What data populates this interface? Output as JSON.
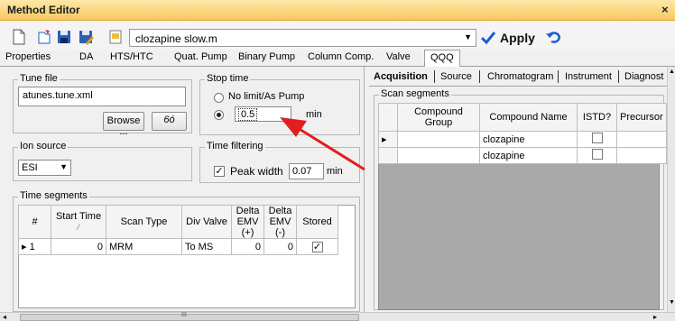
{
  "window": {
    "title": "Method Editor",
    "close_glyph": "×"
  },
  "toolbar": {
    "method_file": "clozapine slow.m",
    "apply_label": "Apply",
    "icons": [
      "new-icon",
      "open-icon",
      "save-icon",
      "save-as-icon",
      "print-preview-icon",
      "apply-check-icon",
      "undo-icon"
    ]
  },
  "tabs": [
    "Properties",
    "DA",
    "HTS/HTC",
    "Quat. Pump",
    "Binary Pump",
    "Column Comp.",
    "Valve",
    "QQQ"
  ],
  "left": {
    "tune_file": {
      "label": "Tune file",
      "value": "atunes.tune.xml",
      "browse_label": "Browse ...",
      "glasses_glyph": "6ó"
    },
    "stop_time": {
      "label": "Stop time",
      "option_nolimit": "No limit/As Pump",
      "value": "0.5",
      "unit": "min"
    },
    "ion_source": {
      "label": "Ion source",
      "value": "ESI"
    },
    "time_filtering": {
      "label": "Time filtering",
      "option": "Peak width",
      "value": "0.07",
      "unit": "min"
    },
    "time_segments": {
      "label": "Time segments",
      "headers": [
        "#",
        "Start Time",
        "Scan Type",
        "Div Valve",
        "Delta EMV (+)",
        "Delta EMV (-)",
        "Stored"
      ],
      "row": {
        "num": "1",
        "start": "0",
        "scan": "MRM",
        "div": "To MS",
        "emv_pos": "0",
        "emv_neg": "0"
      }
    }
  },
  "right": {
    "tabs": [
      "Acquisition",
      "Source",
      "Chromatogram",
      "Instrument",
      "Diagnosti"
    ],
    "scan_segments_label": "Scan segments",
    "headers": [
      "Compound Group",
      "Compound Name",
      "ISTD?",
      "Precursor"
    ],
    "rows": [
      {
        "group": "",
        "name": "clozapine"
      },
      {
        "group": "",
        "name": "clozapine"
      }
    ]
  },
  "scrollbar": {
    "thumb_glyph": "III"
  },
  "colors": {
    "titlebar": "#f8c860",
    "arrow": "#e02020",
    "check_blue": "#1a5fd0"
  }
}
